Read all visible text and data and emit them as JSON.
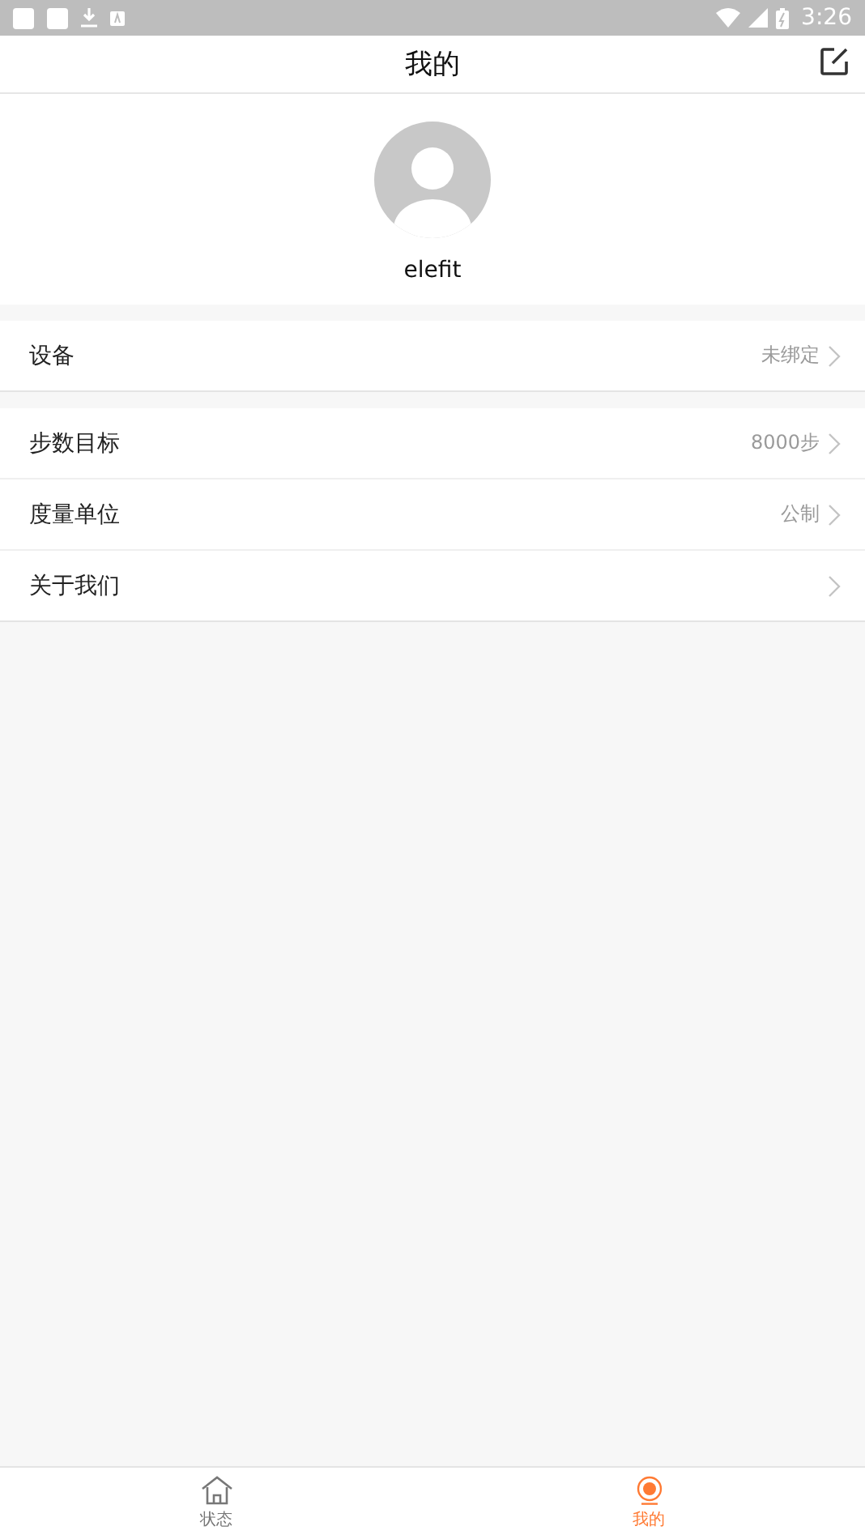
{
  "status_bar": {
    "time": "3:26"
  },
  "header": {
    "title": "我的"
  },
  "profile": {
    "name": "elefit"
  },
  "sections": [
    {
      "rows": [
        {
          "label": "设备",
          "value": "未绑定"
        }
      ]
    },
    {
      "rows": [
        {
          "label": "步数目标",
          "value": "8000步"
        },
        {
          "label": "度量单位",
          "value": "公制"
        },
        {
          "label": "关于我们"
        }
      ]
    }
  ],
  "tabs": [
    {
      "label": "状态",
      "kind": "home",
      "selected": false
    },
    {
      "label": "我的",
      "kind": "me",
      "selected": true
    }
  ]
}
